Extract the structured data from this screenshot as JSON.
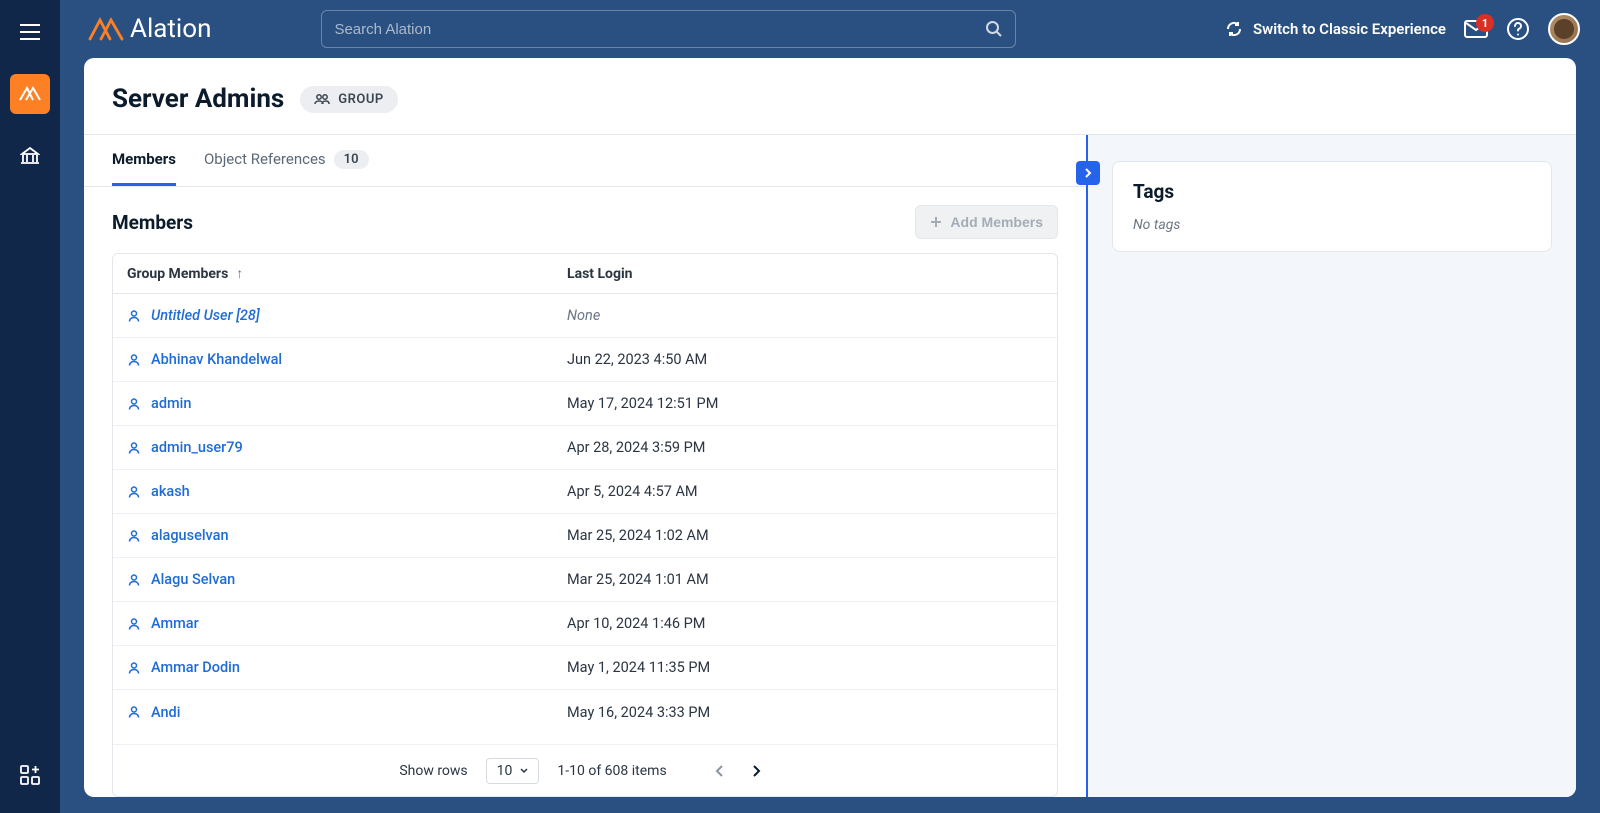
{
  "brand": "Alation",
  "search": {
    "placeholder": "Search Alation"
  },
  "header": {
    "switch_label": "Switch to Classic Experience",
    "notif_count": "1"
  },
  "page": {
    "title": "Server Admins",
    "badge": "GROUP"
  },
  "tabs": {
    "members": "Members",
    "object_refs": "Object References",
    "object_refs_count": "10"
  },
  "section": {
    "title": "Members",
    "add_label": "Add Members"
  },
  "table": {
    "col_name": "Group Members",
    "col_login": "Last Login",
    "rows": [
      {
        "name": "Untitled User [28]",
        "login": "None",
        "italic": true
      },
      {
        "name": "Abhinav Khandelwal",
        "login": "Jun 22, 2023 4:50 AM"
      },
      {
        "name": "admin",
        "login": "May 17, 2024 12:51 PM"
      },
      {
        "name": "admin_user79",
        "login": "Apr 28, 2024 3:59 PM"
      },
      {
        "name": "akash",
        "login": "Apr 5, 2024 4:57 AM"
      },
      {
        "name": "alaguselvan",
        "login": "Mar 25, 2024 1:02 AM"
      },
      {
        "name": "Alagu Selvan",
        "login": "Mar 25, 2024 1:01 AM"
      },
      {
        "name": "Ammar",
        "login": "Apr 10, 2024 1:46 PM"
      },
      {
        "name": "Ammar Dodin",
        "login": "May 1, 2024 11:35 PM"
      },
      {
        "name": "Andi",
        "login": "May 16, 2024 3:33 PM"
      }
    ]
  },
  "pagination": {
    "show_label": "Show rows",
    "page_size": "10",
    "range": "1-10 of 608 items"
  },
  "right": {
    "tags_title": "Tags",
    "no_tags": "No tags"
  }
}
